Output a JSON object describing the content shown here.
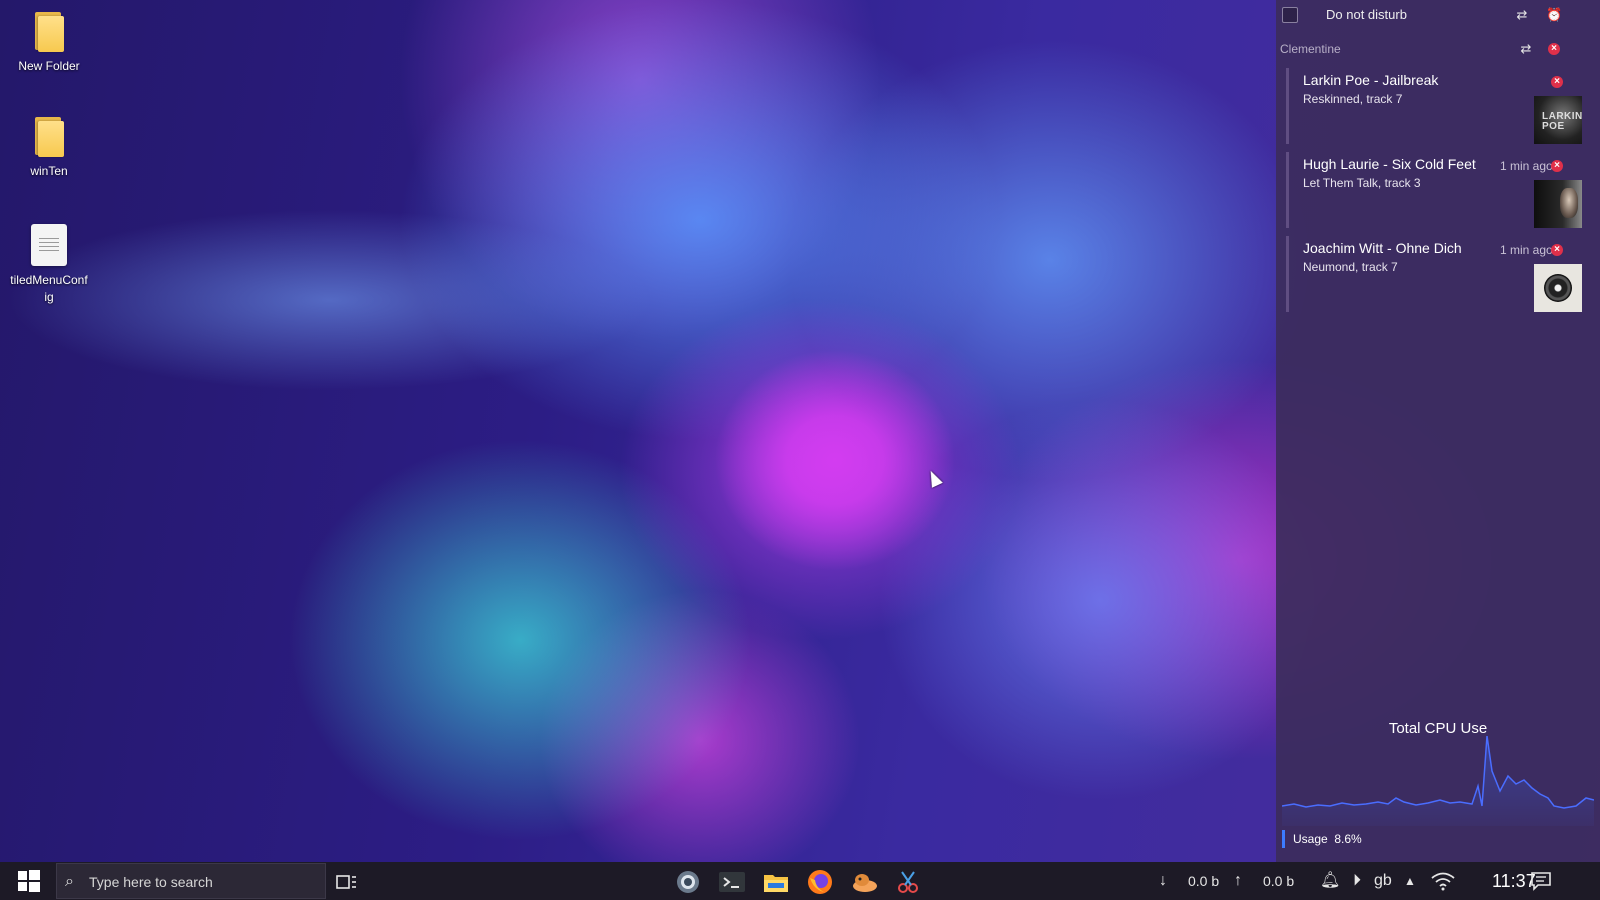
{
  "desktop": {
    "icons": [
      {
        "label": "New Folder",
        "type": "folder-icon"
      },
      {
        "label": "winTen",
        "type": "folder-icon"
      },
      {
        "label": "tiledMenuConfig",
        "type": "file-icon"
      }
    ]
  },
  "notifications": {
    "dnd_label": "Do not disturb",
    "app_name": "Clementine",
    "items": [
      {
        "title": "Larkin Poe - Jailbreak",
        "subtitle": "Reskinned, track 7",
        "time": "",
        "album_text": "LARKIN POE"
      },
      {
        "title": "Hugh Laurie - Six Cold Feet",
        "subtitle": "Let Them Talk, track 3",
        "time": "1 min ago"
      },
      {
        "title": "Joachim Witt - Ohne Dich",
        "subtitle": "Neumond, track 7",
        "time": "1 min ago"
      }
    ]
  },
  "cpu_widget": {
    "title": "Total CPU Use",
    "usage_label": "Usage",
    "usage_value": "8.6%",
    "accent_color": "#3d7bff"
  },
  "taskbar": {
    "search_placeholder": "Type here to search",
    "pinned_apps": [
      "settings-icon",
      "terminal-icon",
      "file-manager-icon",
      "firefox-icon",
      "gimp-icon",
      "screenshot-tool-icon"
    ],
    "net_down": "0.0 b",
    "net_up": "0.0 b",
    "keyboard_layout": "gb",
    "clock": "11:37"
  }
}
